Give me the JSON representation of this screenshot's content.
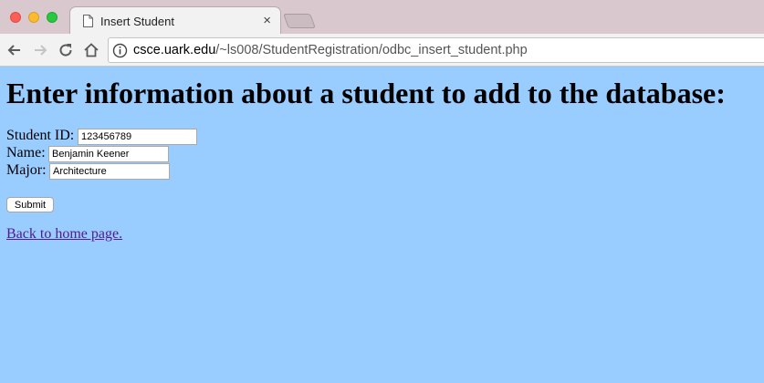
{
  "browser": {
    "tab_title": "Insert Student",
    "tab_close": "×",
    "url_host": "csce.uark.edu",
    "url_path": "/~ls008/StudentRegistration/odbc_insert_student.php"
  },
  "page": {
    "heading": "Enter information about a student to add to the database:",
    "fields": {
      "student_id": {
        "label": "Student ID:",
        "value": "123456789"
      },
      "name": {
        "label": "Name:",
        "value": "Benjamin Keener"
      },
      "major": {
        "label": "Major:",
        "value": "Architecture"
      }
    },
    "submit_label": "Submit",
    "back_link": "Back to home page."
  },
  "colors": {
    "page_background": "#99ccff",
    "visited_link": "#551a8b"
  }
}
